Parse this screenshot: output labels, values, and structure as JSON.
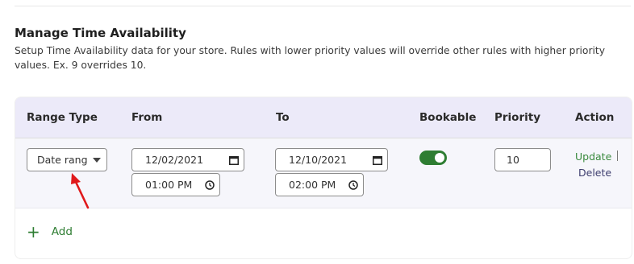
{
  "section": {
    "title": "Manage Time Availability",
    "description": "Setup Time Availability data for your store. Rules with lower priority values will override other rules with higher priority values. Ex. 9 overrides 10."
  },
  "table": {
    "headers": {
      "range_type": "Range Type",
      "from": "From",
      "to": "To",
      "bookable": "Bookable",
      "priority": "Priority",
      "action": "Action"
    },
    "rows": [
      {
        "range_type": "Date range",
        "from_date": "12/02/2021",
        "from_time": "01:00 PM",
        "to_date": "12/10/2021",
        "to_time": "02:00 PM",
        "bookable": true,
        "priority": "10",
        "update_label": "Update",
        "delete_label": "Delete"
      }
    ]
  },
  "add_label": "Add",
  "colors": {
    "header_bg": "#eceaf9",
    "row_bg": "#f6f6fb",
    "accent_green": "#2e7d32",
    "arrow_red": "#e0191b"
  },
  "icons": {
    "dropdown": "caret-down-icon",
    "date": "calendar-icon",
    "time": "clock-icon",
    "add": "plus-icon"
  }
}
